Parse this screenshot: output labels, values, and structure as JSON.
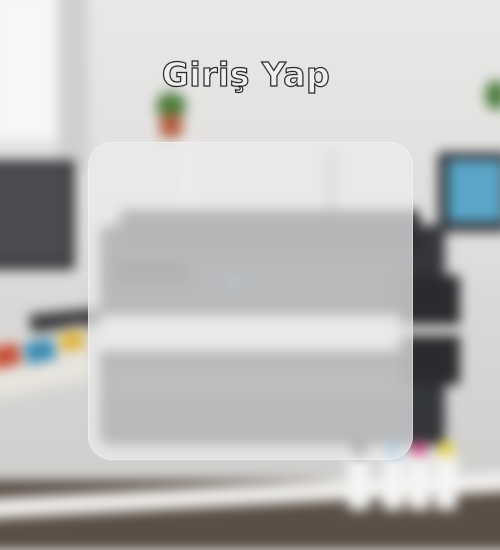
{
  "login": {
    "title": "Giriş Yap"
  },
  "background": {
    "description_colors": {
      "wall": "#e9e9e8",
      "desk": "#dadad9",
      "printer": "#34363a",
      "panel_tint": "rgba(236,236,236,0.72)"
    }
  }
}
